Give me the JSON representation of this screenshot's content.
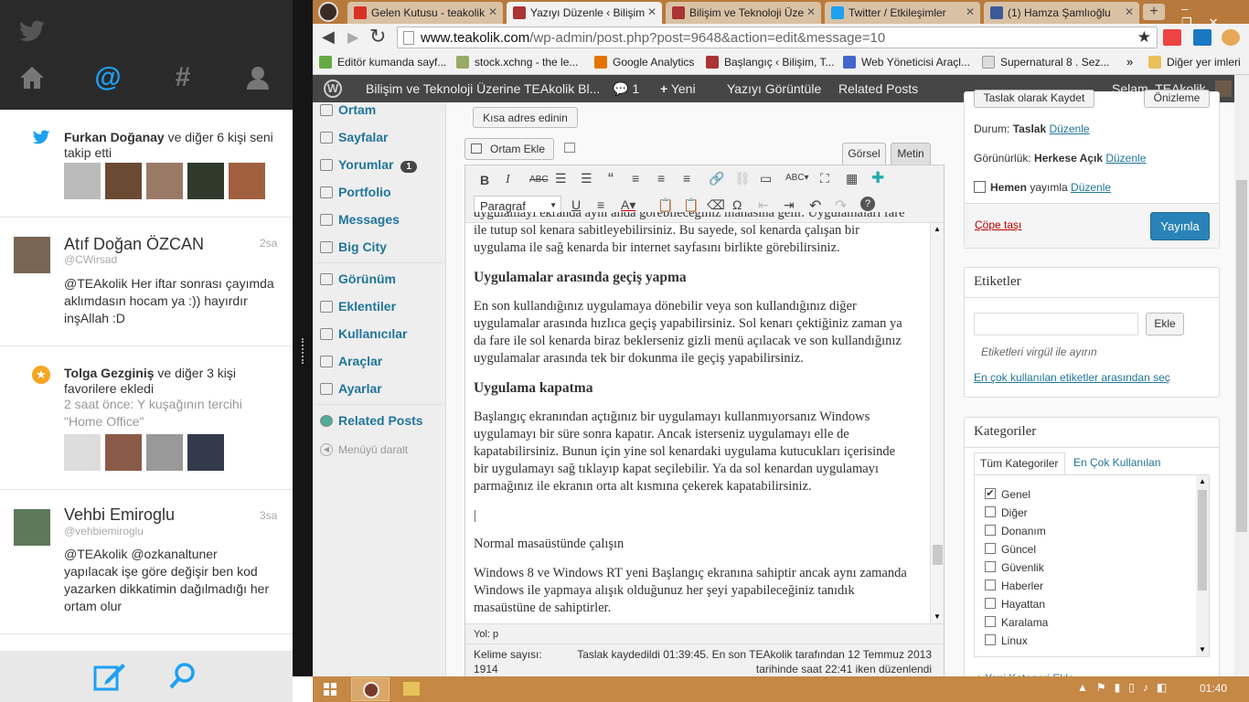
{
  "twitter": {
    "notifications": [
      {
        "name": "Furkan Doğanay",
        "text": " ve diğer 6 kişi seni takip etti"
      },
      {
        "name": "Tolga Gezginiş",
        "text": " ve diğer 3 kişi favorilere ekledi",
        "sub": "2 saat önce: Y kuşağının tercihi \"Home Office\""
      }
    ],
    "tweets": [
      {
        "name": "Atıf Doğan ÖZCAN",
        "handle": "@CWirsad",
        "time": "2sa",
        "text": "@TEAkolik  Her iftar sonrası çayımda aklımdasın hocam ya :)) hayırdır inşAllah :D"
      },
      {
        "name": "Vehbi Emiroglu",
        "handle": "@vehbiemiroglu",
        "time": "3sa",
        "text": "@TEAkolik @ozkanaltuner yapılacak işe göre değişir ben kod yazarken dikkatimin dağılmadığı her ortam olur"
      }
    ]
  },
  "tabs": [
    {
      "label": "Gelen Kutusu - teakolik",
      "color": "#d93025"
    },
    {
      "label": "Yazıyı Düzenle ‹ Bilişim",
      "color": "#a33"
    },
    {
      "label": "Bilişim ve Teknoloji Üze",
      "color": "#a33"
    },
    {
      "label": "Twitter / Etkileşimler",
      "color": "#1da1f2"
    },
    {
      "label": "(1) Hamza Şamlıoğlu",
      "color": "#3b5998"
    }
  ],
  "url": {
    "host": "www.teakolik.com",
    "path": "/wp-admin/post.php?post=9648&action=edit&message=10"
  },
  "bookmarks": [
    {
      "label": "Editör kumanda sayf...",
      "color": "#6a4"
    },
    {
      "label": "stock.xchng - the le...",
      "color": "#9a6"
    },
    {
      "label": "Google Analytics",
      "color": "#e37400"
    },
    {
      "label": "Başlangıç ‹ Bilişim, T...",
      "color": "#a33"
    },
    {
      "label": "Web Yöneticisi Araçl...",
      "color": "#46c"
    },
    {
      "label": "Supernatural 8 . Sez...",
      "color": "#ddd"
    },
    {
      "label": "Diğer yer imleri",
      "color": "#e8c15a"
    }
  ],
  "wpbar": {
    "site": "Bilişim ve Teknoloji Üzerine TEAkolik Bl...",
    "comments": "1",
    "new": "Yeni",
    "view": "Yazıyı Görüntüle",
    "related": "Related Posts",
    "greeting": "Selam, TEAkolik"
  },
  "menu": [
    {
      "label": "Ortam"
    },
    {
      "label": "Sayfalar"
    },
    {
      "label": "Yorumlar",
      "badge": "1"
    },
    {
      "label": "Portfolio"
    },
    {
      "label": "Messages"
    },
    {
      "label": "Big City"
    },
    {
      "label": "Görünüm"
    },
    {
      "label": "Eklentiler"
    },
    {
      "label": "Kullanıcılar"
    },
    {
      "label": "Araçlar"
    },
    {
      "label": "Ayarlar"
    },
    {
      "label": "Related Posts"
    }
  ],
  "menu_collapse": "Menüyü daralt",
  "editor": {
    "shortlink": "Kısa adres edinin",
    "media": "Ortam Ekle",
    "tab_visual": "Görsel",
    "tab_text": "Metin",
    "format": "Paragraf",
    "path": "Yol: p",
    "wordcount": "Kelime sayısı: 1914",
    "saved": "Taslak kaydedildi 01:39:45. En son TEAkolik tarafından 12 Temmuz 2013 tarihinde saat 22:41 iken düzenlendi",
    "content": [
      {
        "t": "p",
        "v": "uygulamayı ekranda aynı anda görebileceğiniz manasına gelir. Uygulamaları fare ile tutup sol kenara sabitleyebilirsiniz. Bu sayede, sol kenarda çalışan bir uygulama ile sağ kenarda bir internet sayfasını birlikte görebilirsiniz."
      },
      {
        "t": "h",
        "v": "Uygulamalar arasında geçiş yapma"
      },
      {
        "t": "p",
        "v": "En son kullandığınız uygulamaya dönebilir veya son kullandığınız diğer uygulamalar arasında hızlıca geçiş yapabilirsiniz. Sol kenarı çektiğiniz zaman ya da fare ile sol kenarda biraz beklerseniz gizli menü açılacak ve son kullandığınız uygulamalar arasında tek bir dokunma ile geçiş yapabilirsiniz."
      },
      {
        "t": "h",
        "v": "Uygulama kapatma"
      },
      {
        "t": "p",
        "v": "Başlangıç ekranından açtığınız bir uygulamayı kullanmıyorsanız Windows uygulamayı bir süre sonra kapatır. Ancak isterseniz uygulamayı elle de kapatabilirsiniz. Bunun için yine sol kenardaki uygulama kutucukları içerisinde bir uygulamayı sağ tıklayıp kapat seçilebilir. Ya da sol kenardan uygulamayı parmağınız ile ekranın orta alt kısmına çekerek kapatabilirsiniz."
      },
      {
        "t": "p",
        "v": "|"
      },
      {
        "t": "p",
        "v": "Normal masaüstünde çalışın"
      },
      {
        "t": "p",
        "v": "Windows 8 ve Windows RT yeni Başlangıç ekranına sahiptir ancak aynı zamanda Windows ile yapmaya alışık olduğunuz her şeyi yapabileceğiniz tanıdık masaüstüne de sahiptirler."
      }
    ]
  },
  "publish": {
    "save": "Taslak olarak Kaydet",
    "preview": "Önizleme",
    "status_label": "Durum:",
    "status": "Taslak",
    "edit": "Düzenle",
    "visibility_label": "Görünürlük:",
    "visibility": "Herkese Açık",
    "schedule_b": "Hemen",
    "schedule": "yayımla",
    "trash": "Çöpe taşı",
    "publish": "Yayınla"
  },
  "tags": {
    "title": "Etiketler",
    "add": "Ekle",
    "hint": "Etiketleri virgül ile ayırın",
    "popular": "En çok kullanılan etiketler arasından seç"
  },
  "categories": {
    "title": "Kategoriler",
    "tab_all": "Tüm Kategoriler",
    "tab_pop": "En Çok Kullanılan",
    "items": [
      {
        "label": "Genel",
        "checked": true
      },
      {
        "label": "Diğer"
      },
      {
        "label": "Donanım"
      },
      {
        "label": "Güncel"
      },
      {
        "label": "Güvenlik"
      },
      {
        "label": "Haberler"
      },
      {
        "label": "Hayattan"
      },
      {
        "label": "Karalama"
      },
      {
        "label": "Linux"
      }
    ],
    "add_new": "+ Yeni Kategori Ekle"
  },
  "taskbar": {
    "time": "01:40"
  }
}
